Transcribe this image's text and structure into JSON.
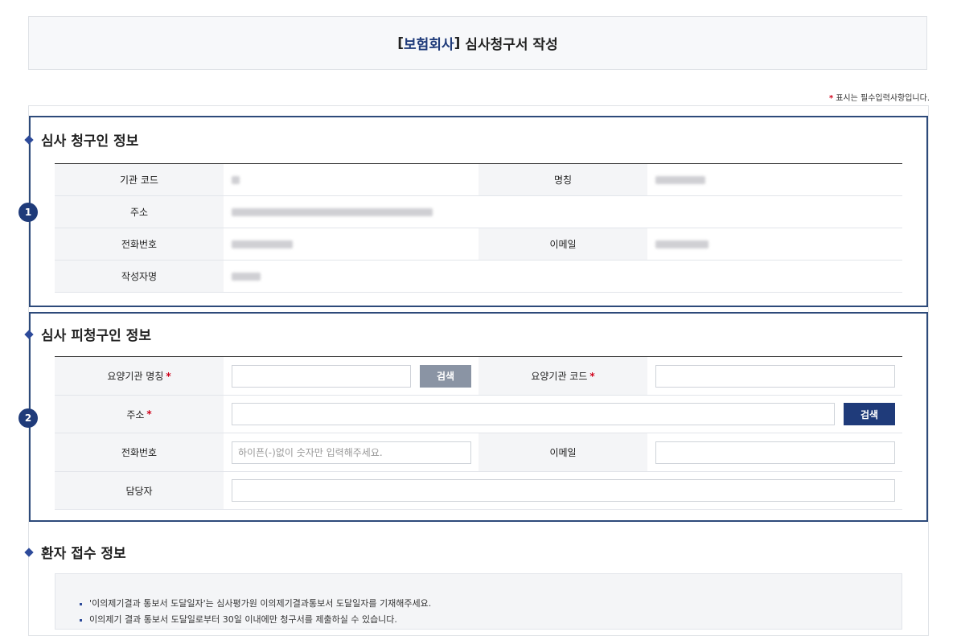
{
  "page": {
    "title_bracket_open": "[",
    "title_highlight": "보험회사",
    "title_bracket_close": "]",
    "title_rest": " 심사청구서 작성",
    "required_star": "*",
    "required_note": "표시는 필수입력사항입니다."
  },
  "section1": {
    "badge": "1",
    "heading": "심사 청구인 정보",
    "rows": [
      {
        "label1": "기관 코드",
        "label2": "명칭"
      },
      {
        "label1": "주소"
      },
      {
        "label1": "전화번호",
        "label2": "이메일"
      },
      {
        "label1": "작성자명"
      }
    ]
  },
  "section2": {
    "badge": "2",
    "heading": "심사 피청구인 정보",
    "org_name_label": "요양기관 명칭",
    "org_code_label": "요양기관 코드",
    "address_label": "주소",
    "phone_label": "전화번호",
    "email_label": "이메일",
    "manager_label": "담당자",
    "req_mark": "*",
    "search_button": "검색",
    "address_search_button": "검색",
    "phone_placeholder": "하이픈(-)없이 숫자만 입력해주세요."
  },
  "section3": {
    "heading": "환자 접수 정보",
    "notices": [
      "'이의제기결과 통보서 도달일자'는 심사평가원 이의제기결과통보서 도달일자를 기재해주세요.",
      "이의제기 결과 통보서 도달일로부터 30일 이내에만 청구서를 제출하실 수 있습니다."
    ]
  },
  "colors": {
    "accent": "#1f3b7a",
    "section_border": "#2d4a7a",
    "required": "#d0021b",
    "label_bg": "#f4f5f7",
    "search_gray": "#8a94a4"
  }
}
